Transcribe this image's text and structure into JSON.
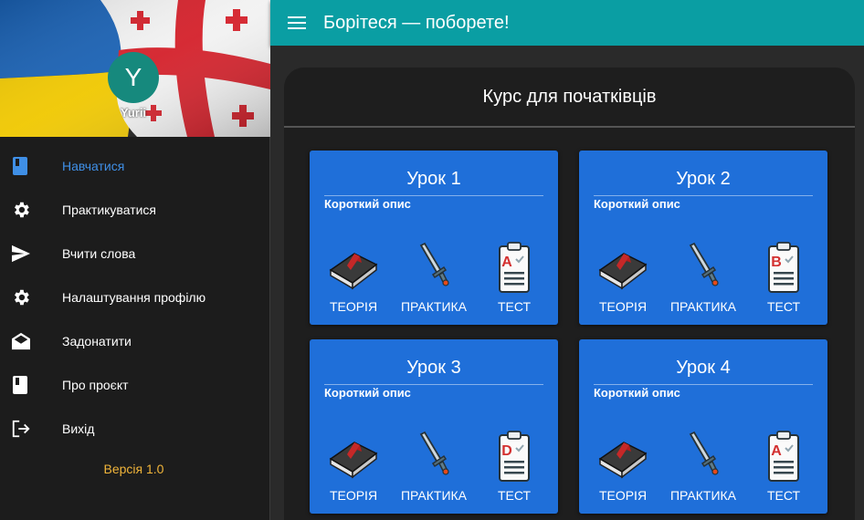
{
  "user": {
    "initial": "Y",
    "name": "Yurii"
  },
  "nav": [
    {
      "label": "Навчатися",
      "icon": "book-icon",
      "active": true
    },
    {
      "label": "Практикуватися",
      "icon": "gear-icon"
    },
    {
      "label": "Вчити слова",
      "icon": "send-icon"
    },
    {
      "label": "Налаштування профілю",
      "icon": "gear-icon"
    },
    {
      "label": "Задонатити",
      "icon": "envelope-icon"
    },
    {
      "label": "Про проєкт",
      "icon": "book-icon"
    },
    {
      "label": "Вихід",
      "icon": "logout-icon"
    }
  ],
  "version": "Версія 1.0",
  "header": {
    "title": "Борітеся — поборете!"
  },
  "course": {
    "title": "Курс для початківців"
  },
  "lessons": [
    {
      "title": "Урок 1",
      "description": "Короткий опис",
      "test_grade": "A",
      "actions": [
        "ТЕОРІЯ",
        "ПРАКТИКА",
        "ТЕСТ"
      ]
    },
    {
      "title": "Урок 2",
      "description": "Короткий опис",
      "test_grade": "B",
      "actions": [
        "ТЕОРІЯ",
        "ПРАКТИКА",
        "ТЕСТ"
      ]
    },
    {
      "title": "Урок 3",
      "description": "Короткий опис",
      "test_grade": "D",
      "actions": [
        "ТЕОРІЯ",
        "ПРАКТИКА",
        "ТЕСТ"
      ]
    },
    {
      "title": "Урок 4",
      "description": "Короткий опис",
      "test_grade": "A",
      "actions": [
        "ТЕОРІЯ",
        "ПРАКТИКА",
        "ТЕСТ"
      ]
    }
  ],
  "colors": {
    "topbar": "#0a9ea3",
    "card": "#1f6fd9",
    "active_nav": "#3f8fe6",
    "version": "#f0b43a",
    "avatar": "#16897d"
  }
}
